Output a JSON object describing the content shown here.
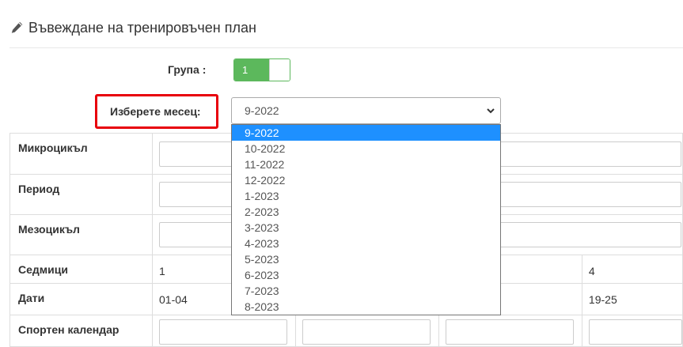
{
  "page": {
    "title": "Въвеждане на тренировъчен план",
    "icon": "pencil-icon"
  },
  "group": {
    "label": "Група :",
    "toggle_value": "1",
    "accent": "#5cb85c"
  },
  "month": {
    "label": "Изберете месец:",
    "selected": "9-2022",
    "highlight_color": "#e8000b",
    "options": [
      "9-2022",
      "10-2022",
      "11-2022",
      "12-2022",
      "1-2023",
      "2-2023",
      "3-2023",
      "4-2023",
      "5-2023",
      "6-2023",
      "7-2023",
      "8-2023"
    ]
  },
  "table": {
    "rows": {
      "microcycle": "Микроцикъл",
      "period": "Период",
      "mesocycle": "Мезоцикъл",
      "weeks": "Седмици",
      "dates": "Дати",
      "sport_calendar": "Спортен календар"
    },
    "weeks": [
      "1",
      "4"
    ],
    "dates": [
      "01-04",
      "19-25"
    ]
  }
}
